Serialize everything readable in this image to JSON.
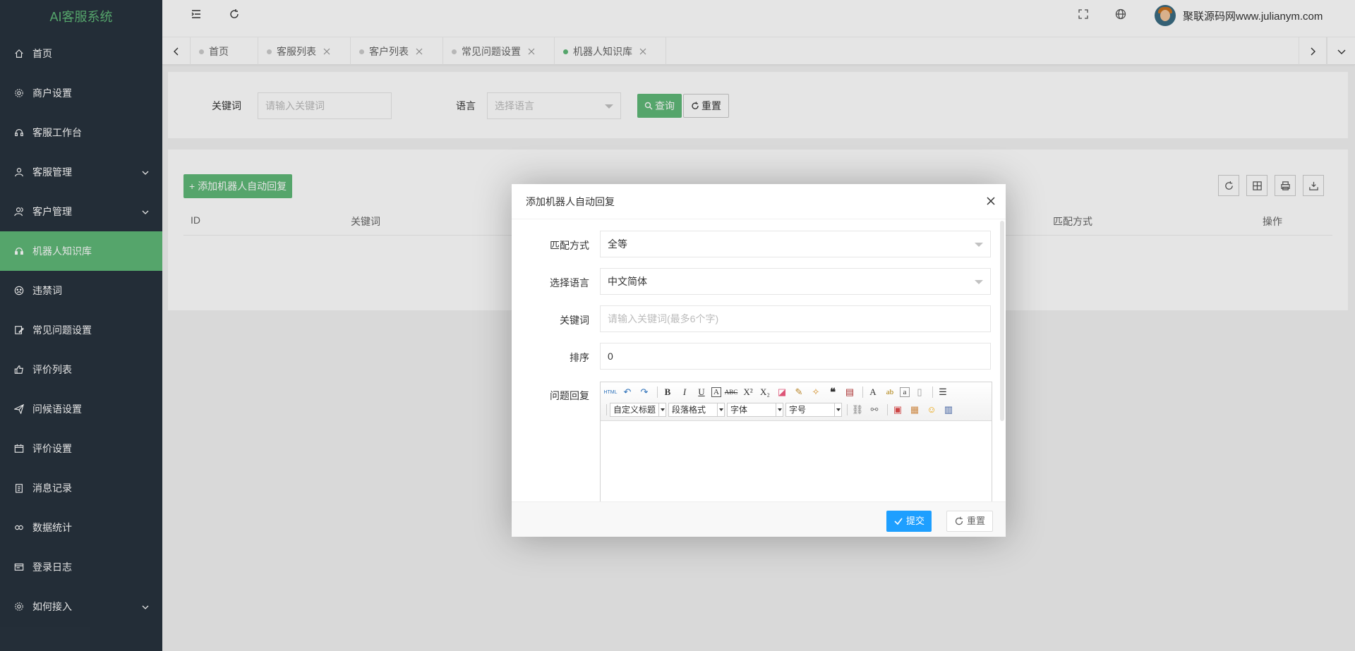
{
  "app": {
    "title": "AI客服系统"
  },
  "sidebar": {
    "items": [
      {
        "label": "首页",
        "icon": "home-icon"
      },
      {
        "label": "商户设置",
        "icon": "gear-icon"
      },
      {
        "label": "客服工作台",
        "icon": "headset-icon"
      },
      {
        "label": "客服管理",
        "icon": "user-icon"
      },
      {
        "label": "客户管理",
        "icon": "users-icon"
      },
      {
        "label": "机器人知识库",
        "icon": "headset-icon"
      },
      {
        "label": "违禁词",
        "icon": "sad-face-icon"
      },
      {
        "label": "常见问题设置",
        "icon": "edit-icon"
      },
      {
        "label": "评价列表",
        "icon": "thumb-up-icon"
      },
      {
        "label": "问候语设置",
        "icon": "send-icon"
      },
      {
        "label": "评价设置",
        "icon": "calendar-icon"
      },
      {
        "label": "消息记录",
        "icon": "clipboard-icon"
      },
      {
        "label": "数据统计",
        "icon": "link-icon"
      },
      {
        "label": "登录日志",
        "icon": "log-icon"
      },
      {
        "label": "如何接入",
        "icon": "gear-icon"
      }
    ],
    "active_index": 5,
    "active_color": "#5fb878"
  },
  "header": {
    "username": "聚联源码网www.julianym.com"
  },
  "tabs": [
    {
      "label": "首页"
    },
    {
      "label": "客服列表"
    },
    {
      "label": "客户列表"
    },
    {
      "label": "常见问题设置"
    },
    {
      "label": "机器人知识库"
    }
  ],
  "search": {
    "keyword_label": "关键词",
    "keyword_placeholder": "请输入关键词",
    "language_label": "语言",
    "language_placeholder": "选择语言",
    "query_button": "查询",
    "reset_button": "重置"
  },
  "table": {
    "add_button": "添加机器人自动回复",
    "columns": [
      "ID",
      "关键词",
      "匹配方式",
      "操作"
    ]
  },
  "modal": {
    "title": "添加机器人自动回复",
    "match_label": "匹配方式",
    "match_value": "全等",
    "language_label": "选择语言",
    "language_value": "中文简体",
    "keyword_label": "关键词",
    "keyword_placeholder": "请输入关键词(最多6个字)",
    "sort_label": "排序",
    "sort_value": "0",
    "reply_label": "问题回复",
    "editor": {
      "custom_title": "自定义标题",
      "paragraph": "段落格式",
      "font_family": "字体",
      "font_size": "字号"
    },
    "submit_button": "提交",
    "reset_button": "重置"
  },
  "colors": {
    "primary_green": "#5fb878",
    "primary_blue": "#1e9fff",
    "sidebar_bg": "#28333e"
  }
}
